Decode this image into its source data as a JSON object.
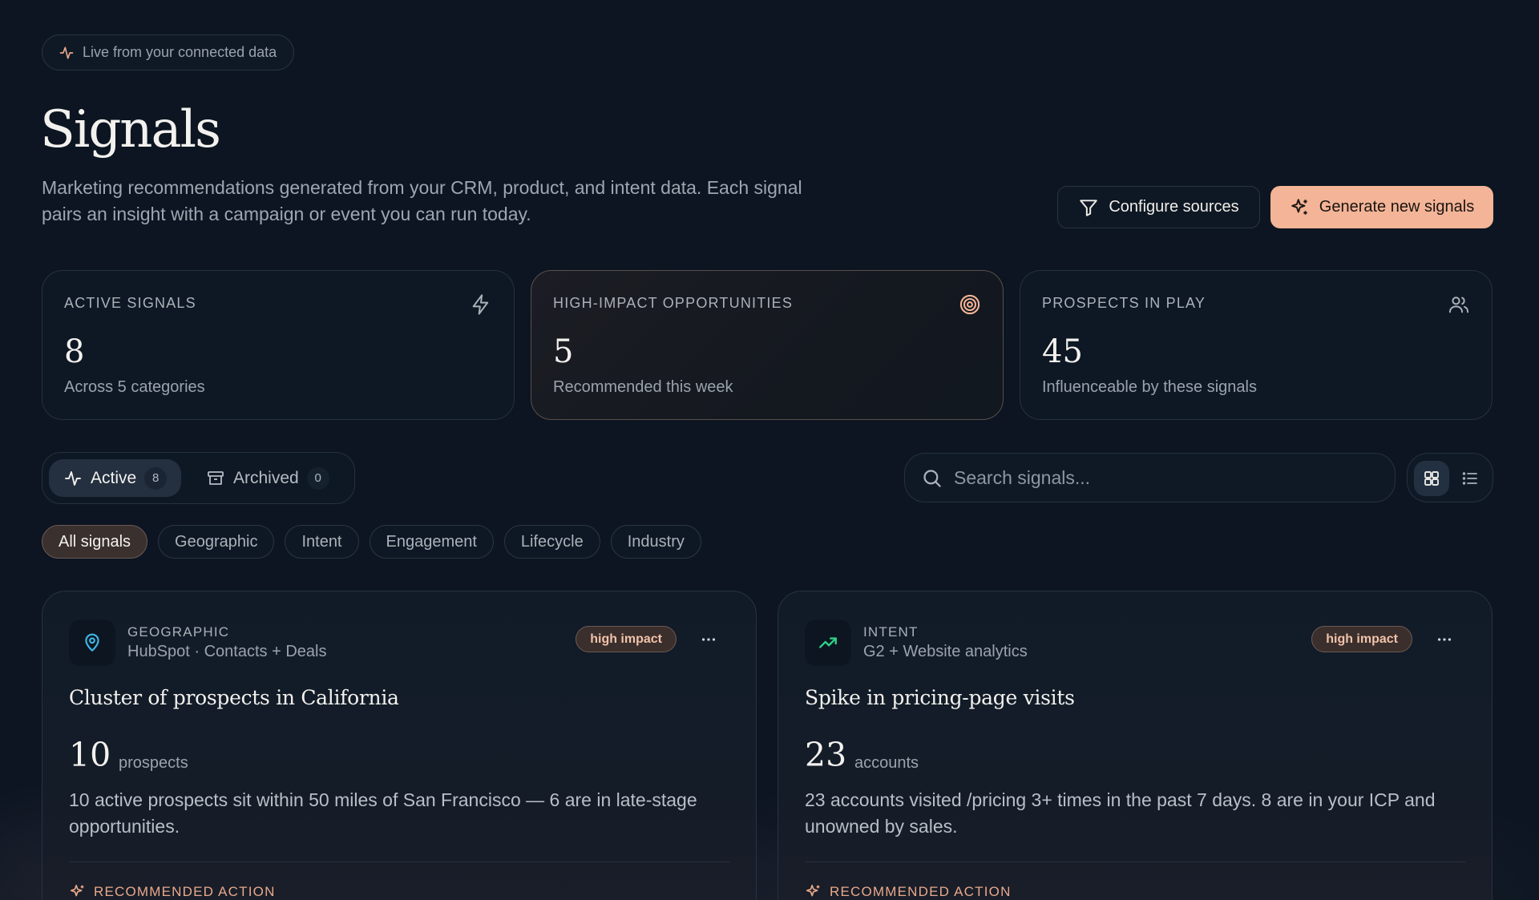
{
  "header": {
    "live_badge": "Live from your connected data",
    "title": "Signals",
    "subtitle": "Marketing recommendations generated from your CRM, product, and intent data. Each signal pairs an insight with a campaign or event you can run today.",
    "configure_label": "Configure sources",
    "generate_label": "Generate new signals"
  },
  "stats": [
    {
      "label": "ACTIVE SIGNALS",
      "value": "8",
      "caption": "Across 5 categories",
      "icon": "lightning-icon"
    },
    {
      "label": "HIGH-IMPACT OPPORTUNITIES",
      "value": "5",
      "caption": "Recommended this week",
      "icon": "target-icon"
    },
    {
      "label": "PROSPECTS IN PLAY",
      "value": "45",
      "caption": "Influenceable by these signals",
      "icon": "users-icon"
    }
  ],
  "tabs": [
    {
      "label": "Active",
      "count": "8"
    },
    {
      "label": "Archived",
      "count": "0"
    }
  ],
  "search": {
    "placeholder": "Search signals..."
  },
  "filters": [
    "All signals",
    "Geographic",
    "Intent",
    "Engagement",
    "Lifecycle",
    "Industry"
  ],
  "signals": [
    {
      "category": "GEOGRAPHIC",
      "source": "HubSpot · Contacts + Deals",
      "badge": "high impact",
      "title": "Cluster of prospects in California",
      "number": "10",
      "unit": "prospects",
      "description": "10 active prospects sit within 50 miles of San Francisco — 6 are in late-stage opportunities.",
      "action_label": "RECOMMENDED ACTION",
      "icon": "map-pin-icon"
    },
    {
      "category": "INTENT",
      "source": "G2 + Website analytics",
      "badge": "high impact",
      "title": "Spike in pricing-page visits",
      "number": "23",
      "unit": "accounts",
      "description": "23 accounts visited /pricing 3+ times in the past 7 days. 8 are in your ICP and unowned by sales.",
      "action_label": "RECOMMENDED ACTION",
      "icon": "trending-up-icon"
    }
  ],
  "colors": {
    "background": "#0c1521",
    "accent": "#f3b497",
    "badge_text": "#f2c2aa",
    "geo_icon": "#3fb6e6",
    "intent_icon": "#2fd08a"
  }
}
